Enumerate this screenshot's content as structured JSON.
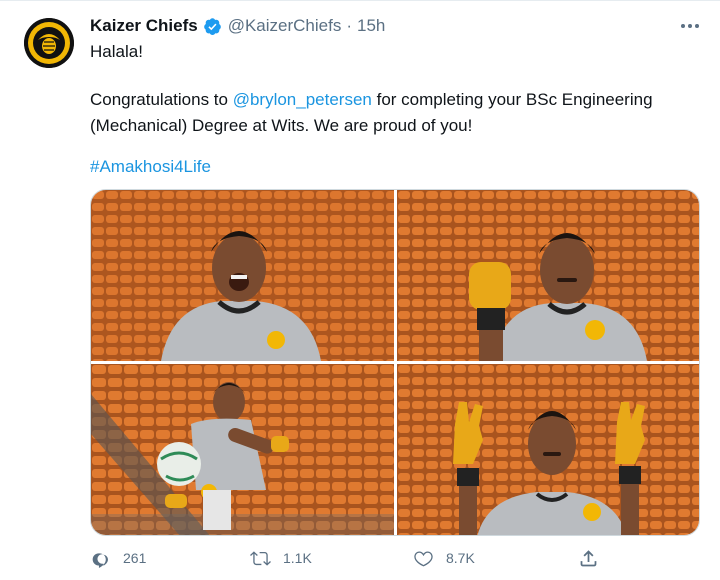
{
  "author": {
    "name": "Kaizer Chiefs",
    "handle": "@KaizerChiefs",
    "separator": "·",
    "time": "15h",
    "avatar_logo_text": "KAIZER CHIEFS"
  },
  "tweet": {
    "line1": "Halala!",
    "line2_prefix": "Congratulations to ",
    "mention": "@brylon_petersen",
    "line2_suffix": " for completing your BSc Engineering",
    "line3": "(Mechanical) Degree at Wits. We are proud of you!",
    "hashtag": "#Amakhosi4Life"
  },
  "media": {
    "photos": [
      {
        "icon": "player-celebrating-photo"
      },
      {
        "icon": "player-fist-photo"
      },
      {
        "icon": "player-ball-photo"
      },
      {
        "icon": "player-gloves-up-photo"
      }
    ],
    "colors": {
      "seats": "#d9742c",
      "seats_dark": "#9c4a17",
      "jersey": "#b9bcc0",
      "skin": "#7a4b30",
      "glove": "#e8a818"
    }
  },
  "actions": {
    "reply_count": "261",
    "retweet_count": "1.1K",
    "like_count": "8.7K"
  },
  "colors": {
    "text": "#0f1419",
    "secondary": "#5b7083",
    "link": "#1b95e0",
    "verified": "#1d9bf0"
  }
}
